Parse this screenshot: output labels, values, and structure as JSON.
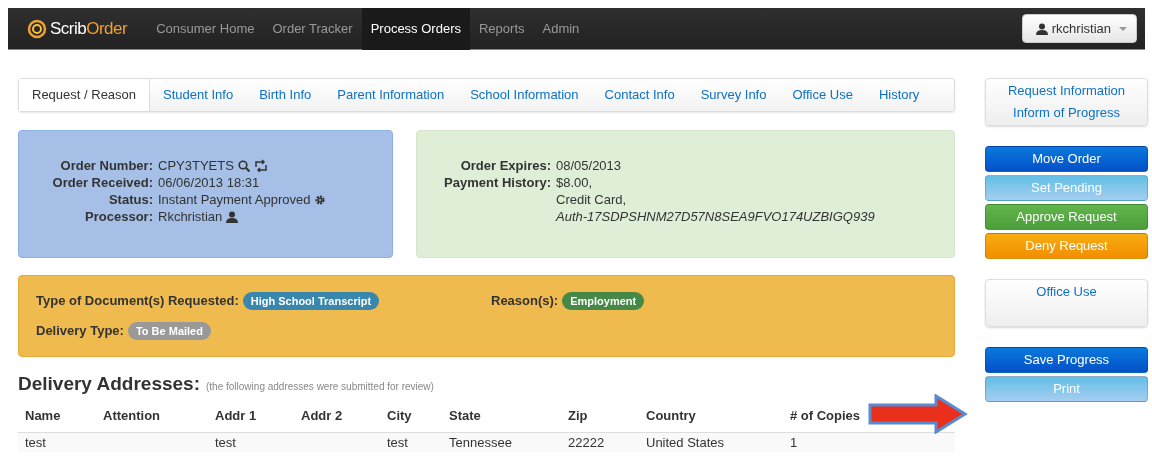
{
  "navbar": {
    "brand": [
      "Scrib",
      "Order"
    ],
    "items": [
      {
        "label": "Consumer Home",
        "selected": false
      },
      {
        "label": "Order Tracker",
        "selected": false
      },
      {
        "label": "Process Orders",
        "selected": true
      },
      {
        "label": "Reports",
        "selected": false
      },
      {
        "label": "Admin",
        "selected": false
      }
    ],
    "user": "rkchristian"
  },
  "tabs": [
    {
      "label": "Request / Reason",
      "selected": true
    },
    {
      "label": "Student Info",
      "selected": false
    },
    {
      "label": "Birth Info",
      "selected": false
    },
    {
      "label": "Parent Information",
      "selected": false
    },
    {
      "label": "School Information",
      "selected": false
    },
    {
      "label": "Contact Info",
      "selected": false
    },
    {
      "label": "Survey Info",
      "selected": false
    },
    {
      "label": "Office Use",
      "selected": false
    },
    {
      "label": "History",
      "selected": false
    }
  ],
  "order_info": [
    {
      "label": "Order Number:",
      "value": "CPY3TYETS",
      "kind": "lookup"
    },
    {
      "label": "Order Received:",
      "value": "06/06/2013 18:31",
      "kind": "plain"
    },
    {
      "label": "Status:",
      "value": "Instant Payment Approved",
      "kind": "setting"
    },
    {
      "label": "Processor:",
      "value": "Rkchristian",
      "kind": "person"
    }
  ],
  "payment_info": [
    {
      "label": "Order Expires:",
      "lines": [
        {
          "text": "08/05/2013",
          "italic": false
        }
      ]
    },
    {
      "label": "Payment History:",
      "lines": [
        {
          "text": "$8.00,",
          "italic": false
        },
        {
          "text": "Credit Card,",
          "italic": false
        },
        {
          "text": "Auth-17SDPSHNM27D57N8SEA9FVO174UZBIGQ939",
          "italic": true
        }
      ]
    }
  ],
  "request": [
    {
      "label": "Type of Document(s) Requested:",
      "badge": "High School Transcript",
      "color": "#3a87ad"
    },
    {
      "label": "Reason(s):",
      "badge": "Employment",
      "color": "#468847"
    },
    {
      "label": "Delivery Type:",
      "badge": "To Be Mailed",
      "color": "#999999"
    }
  ],
  "addresses": {
    "heading": "Delivery Addresses:",
    "note": "(the following addresses were submitted for review)",
    "columns": [
      "Name",
      "Attention",
      "Addr 1",
      "Addr 2",
      "City",
      "State",
      "Zip",
      "Country",
      "# of Copies"
    ],
    "rows": [
      [
        "test",
        "",
        "test",
        "",
        "test",
        "Tennessee",
        "22222",
        "United States",
        "1"
      ]
    ]
  },
  "sidebar": [
    {
      "kind": "links",
      "items": [
        "Request Information",
        "Inform of Progress"
      ]
    },
    {
      "kind": "buttons",
      "items": [
        {
          "label": "Move Order",
          "kind": "primary"
        },
        {
          "label": "Set Pending",
          "kind": "info"
        },
        {
          "label": "Approve Request",
          "kind": "success"
        },
        {
          "label": "Deny Request",
          "kind": "warning"
        }
      ]
    },
    {
      "kind": "links",
      "items": [
        "Office Use"
      ]
    },
    {
      "kind": "buttons",
      "items": [
        {
          "label": "Save Progress",
          "kind": "primary"
        },
        {
          "label": "Print",
          "kind": "info"
        }
      ]
    }
  ]
}
